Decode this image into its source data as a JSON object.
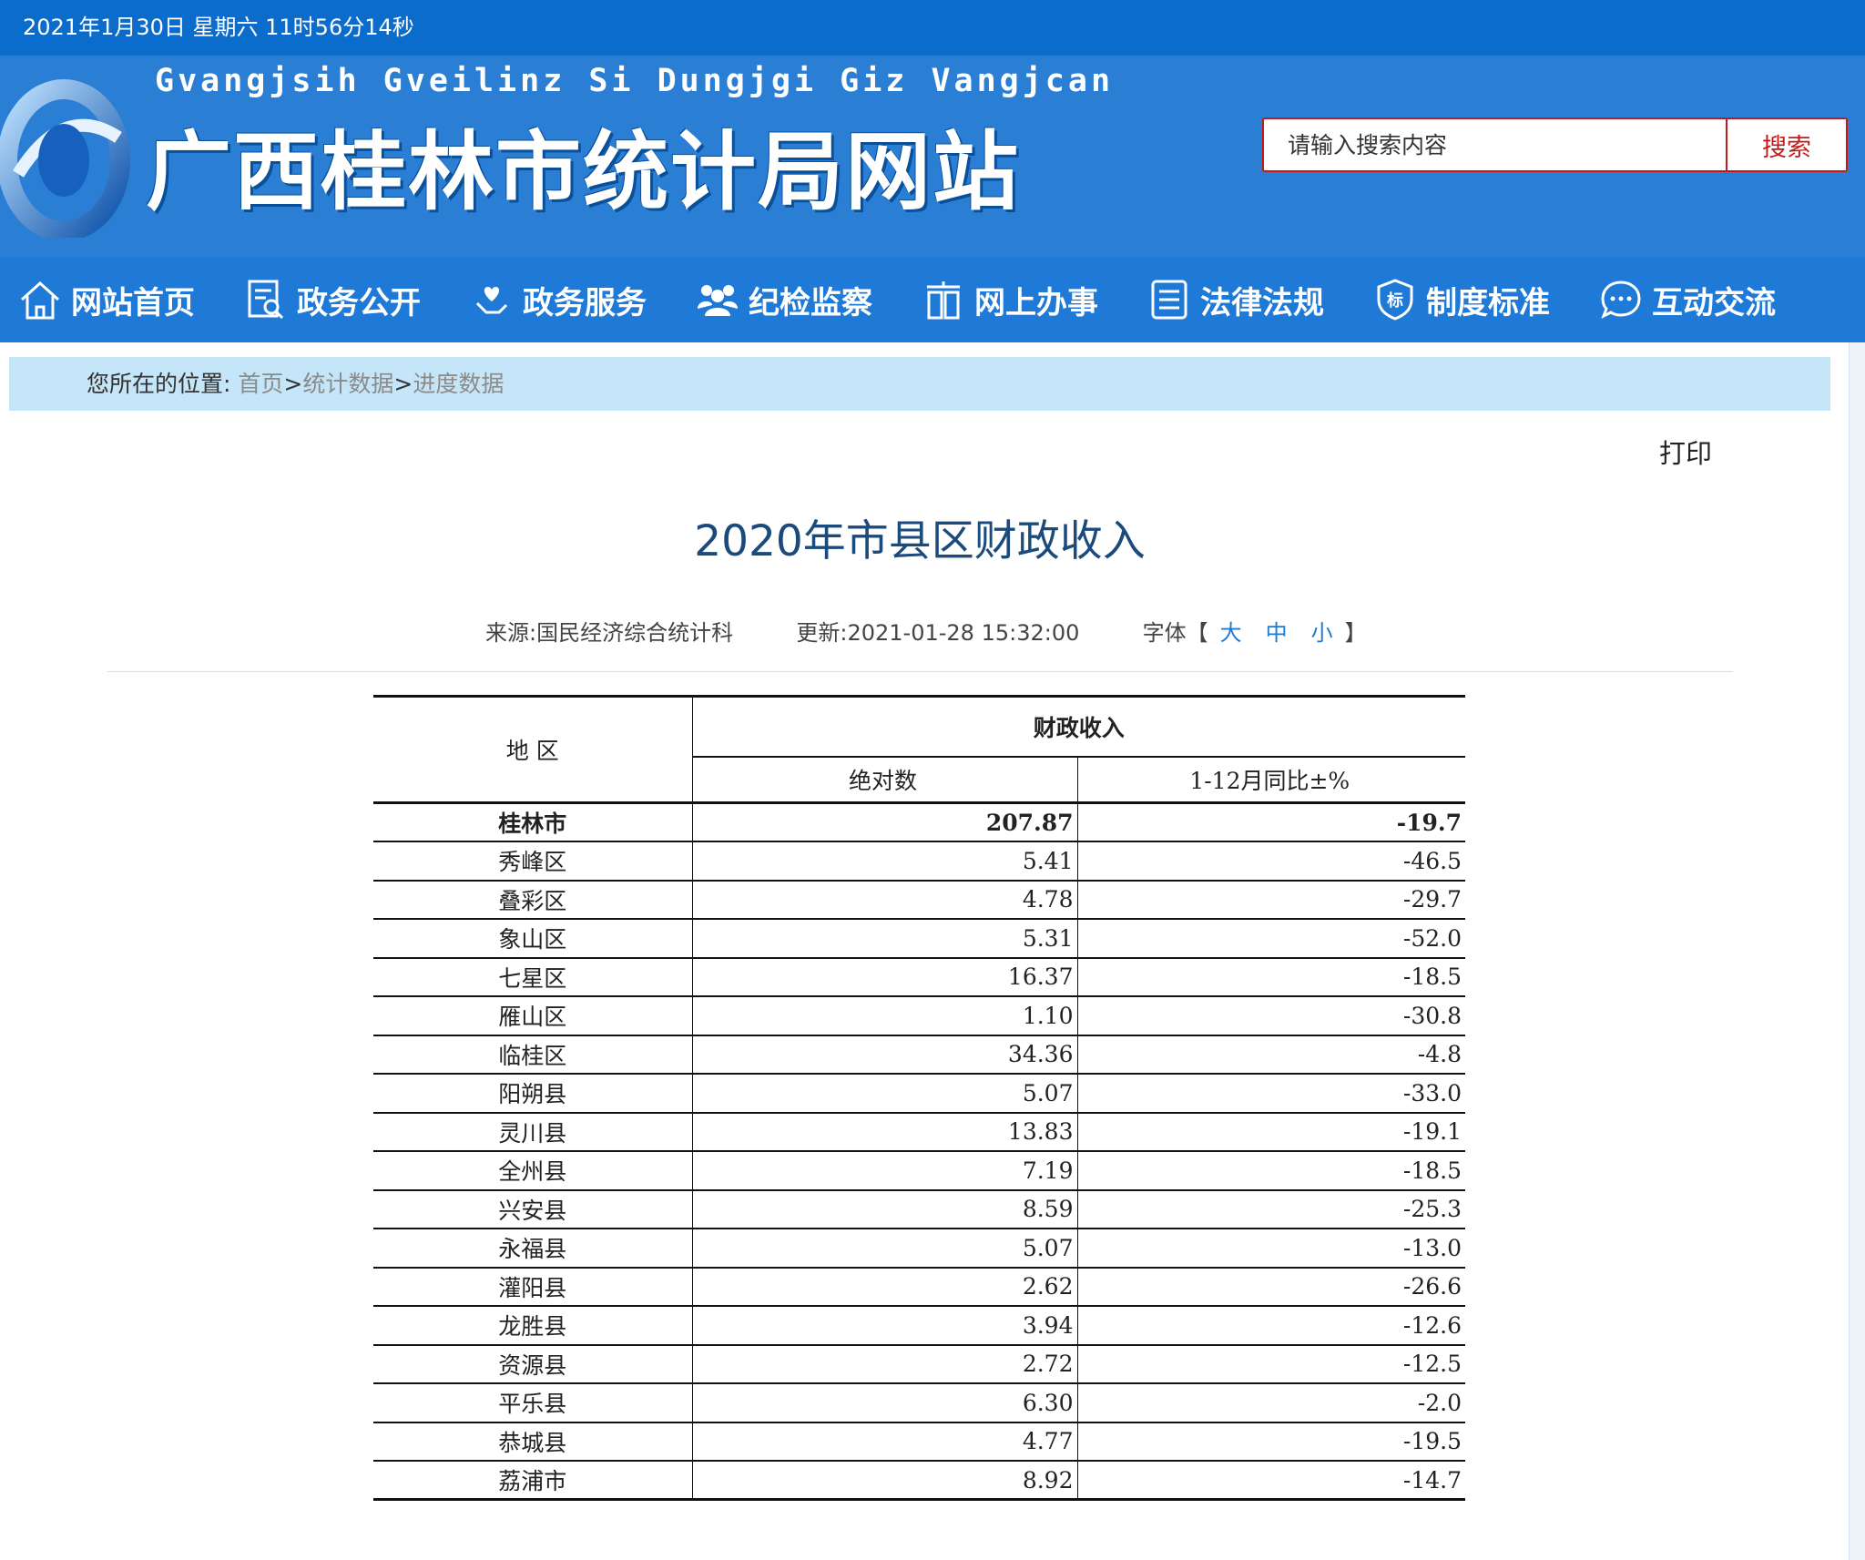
{
  "datebar": {
    "text": "2021年1月30日 星期六 11时56分14秒"
  },
  "header": {
    "site_name_en": "Gvangjsih Gveilinz Si Dungjgi Giz Vangjcan",
    "site_name_cn": "广西桂林市统计局网站",
    "search_placeholder": "请输入搜索内容",
    "search_button": "搜索"
  },
  "nav": {
    "items": [
      {
        "label": "网站首页",
        "icon": "home-icon"
      },
      {
        "label": "政务公开",
        "icon": "document-search-icon"
      },
      {
        "label": "政务服务",
        "icon": "hand-heart-icon"
      },
      {
        "label": "纪检监察",
        "icon": "people-icon"
      },
      {
        "label": "网上办事",
        "icon": "office-icon"
      },
      {
        "label": "法律法规",
        "icon": "list-icon"
      },
      {
        "label": "制度标准",
        "icon": "shield-icon"
      },
      {
        "label": "互动交流",
        "icon": "chat-icon"
      }
    ]
  },
  "breadcrumb": {
    "prefix": "您所在的位置:",
    "items": [
      "首页",
      "统计数据",
      "进度数据"
    ],
    "separator": ">"
  },
  "article": {
    "print_label": "打印",
    "title": "2020年市县区财政收入",
    "source": "来源:国民经济综合统计科",
    "updated": "更新:2021-01-28 15:32:00",
    "font_label": "字体【",
    "font_large": "大",
    "font_medium": "中",
    "font_small": "小",
    "font_close": "】"
  },
  "table": {
    "header_region": "地 区",
    "header_group": "财政收入",
    "header_col1": "绝对数",
    "header_col2": "1-12月同比±%",
    "rows": [
      {
        "region": "桂林市",
        "absolute": "207.87",
        "yoy": "-19.7"
      },
      {
        "region": "秀峰区",
        "absolute": "5.41",
        "yoy": "-46.5"
      },
      {
        "region": "叠彩区",
        "absolute": "4.78",
        "yoy": "-29.7"
      },
      {
        "region": "象山区",
        "absolute": "5.31",
        "yoy": "-52.0"
      },
      {
        "region": "七星区",
        "absolute": "16.37",
        "yoy": "-18.5"
      },
      {
        "region": "雁山区",
        "absolute": "1.10",
        "yoy": "-30.8"
      },
      {
        "region": "临桂区",
        "absolute": "34.36",
        "yoy": "-4.8"
      },
      {
        "region": "阳朔县",
        "absolute": "5.07",
        "yoy": "-33.0"
      },
      {
        "region": "灵川县",
        "absolute": "13.83",
        "yoy": "-19.1"
      },
      {
        "region": "全州县",
        "absolute": "7.19",
        "yoy": "-18.5"
      },
      {
        "region": "兴安县",
        "absolute": "8.59",
        "yoy": "-25.3"
      },
      {
        "region": "永福县",
        "absolute": "5.07",
        "yoy": "-13.0"
      },
      {
        "region": "灌阳县",
        "absolute": "2.62",
        "yoy": "-26.6"
      },
      {
        "region": "龙胜县",
        "absolute": "3.94",
        "yoy": "-12.6"
      },
      {
        "region": "资源县",
        "absolute": "2.72",
        "yoy": "-12.5"
      },
      {
        "region": "平乐县",
        "absolute": "6.30",
        "yoy": "-2.0"
      },
      {
        "region": "恭城县",
        "absolute": "4.77",
        "yoy": "-19.5"
      },
      {
        "region": "荔浦市",
        "absolute": "8.92",
        "yoy": "-14.7"
      }
    ]
  }
}
